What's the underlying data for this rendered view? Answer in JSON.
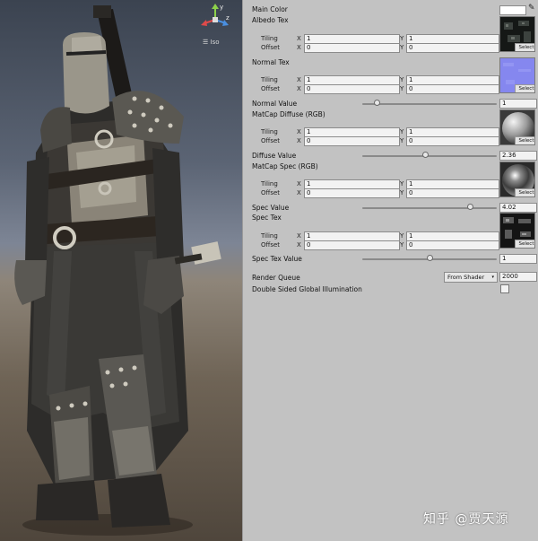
{
  "scene": {
    "view_label": "Iso",
    "gizmo": {
      "y_label": "y",
      "z_label": "z"
    }
  },
  "watermark": "知乎 @贾天源",
  "inspector": {
    "main_color": {
      "label": "Main Color",
      "color": "#ffffff"
    },
    "albedo": {
      "label": "Albedo Tex",
      "tiling": {
        "label": "Tiling",
        "x": "1",
        "y": "1"
      },
      "offset": {
        "label": "Offset",
        "x": "0",
        "y": "0"
      },
      "select": "Select"
    },
    "normal": {
      "label": "Normal Tex",
      "tiling": {
        "label": "Tiling",
        "x": "1",
        "y": "1"
      },
      "offset": {
        "label": "Offset",
        "x": "0",
        "y": "0"
      },
      "select": "Select"
    },
    "normal_value": {
      "label": "Normal Value",
      "value": "1",
      "fraction": 0.11
    },
    "matcap_diffuse": {
      "label": "MatCap Diffuse (RGB)",
      "tiling": {
        "label": "Tiling",
        "x": "1",
        "y": "1"
      },
      "offset": {
        "label": "Offset",
        "x": "0",
        "y": "0"
      },
      "select": "Select"
    },
    "diffuse_value": {
      "label": "Diffuse Value",
      "value": "2.36",
      "fraction": 0.47
    },
    "matcap_spec": {
      "label": "MatCap Spec (RGB)",
      "tiling": {
        "label": "Tiling",
        "x": "1",
        "y": "1"
      },
      "offset": {
        "label": "Offset",
        "x": "0",
        "y": "0"
      },
      "select": "Select"
    },
    "spec_value": {
      "label": "Spec Value",
      "value": "4.02",
      "fraction": 0.8
    },
    "spec_tex": {
      "label": "Spec Tex",
      "tiling": {
        "label": "Tiling",
        "x": "1",
        "y": "1"
      },
      "offset": {
        "label": "Offset",
        "x": "0",
        "y": "0"
      },
      "select": "Select"
    },
    "spec_tex_value": {
      "label": "Spec Tex Value",
      "value": "1",
      "fraction": 0.5
    },
    "render_queue": {
      "label": "Render Queue",
      "option": "From Shader",
      "value": "2000"
    },
    "double_sided_gi": {
      "label": "Double Sided Global Illumination",
      "checked": false
    }
  },
  "axis_labels": {
    "x": "X",
    "y": "Y"
  }
}
